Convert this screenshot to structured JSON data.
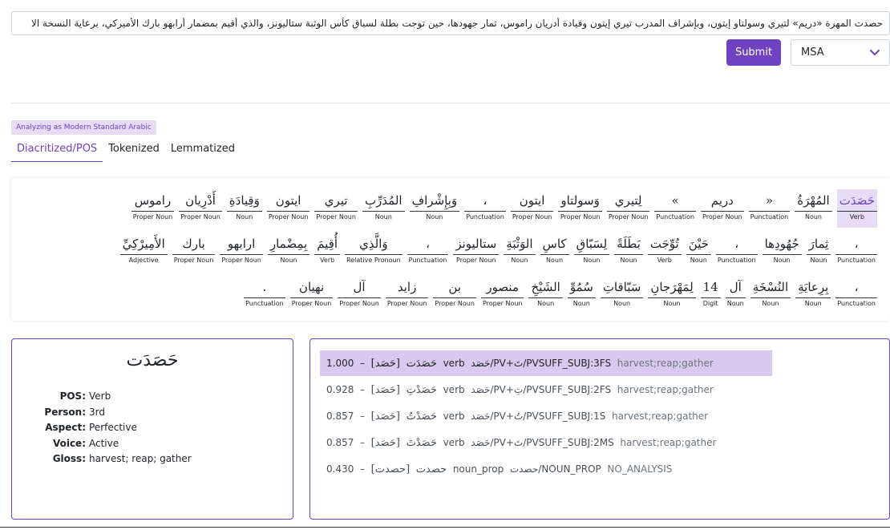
{
  "input": {
    "value": "حصدت المهرة «دريم» لتيري وسولتاو إيتون، وبإشراف المدرب تيري إيتون وقيادة أدريان راموس، ثمار جهودها، حين توجت بطلة لسباق كأس الوثبة ستاليونز، والذي أقيم بمضمار أرابهو بارك الأميركي، برعاية النسخة الا"
  },
  "toolbar": {
    "submit_label": "Submit",
    "dialect": "MSA"
  },
  "mode_badge": "Analyzing as Modern Standard Arabic",
  "tabs": [
    {
      "label": "Diacritized/POS",
      "active": true
    },
    {
      "label": "Tokenized",
      "active": false
    },
    {
      "label": "Lemmatized",
      "active": false
    }
  ],
  "pos_lines": [
    [
      {
        "w": "حَصَدَت",
        "p": "Verb",
        "sel": true
      },
      {
        "w": "المُهْرَةُ",
        "p": "Noun"
      },
      {
        "w": "«",
        "p": "Punctuation"
      },
      {
        "w": "دريم",
        "p": "Proper Noun"
      },
      {
        "w": "»",
        "p": "Punctuation"
      },
      {
        "w": "لِتيري",
        "p": "Proper Noun"
      },
      {
        "w": "وَسولتاو",
        "p": "Proper Noun"
      },
      {
        "w": "ايتون",
        "p": "Proper Noun"
      },
      {
        "w": "،",
        "p": "Punctuation"
      },
      {
        "w": "وَبِإِشْرافِ",
        "p": "Noun"
      },
      {
        "w": "المُدَرِّبِ",
        "p": "Noun"
      },
      {
        "w": "تيري",
        "p": "Proper Noun"
      },
      {
        "w": "ايتون",
        "p": "Proper Noun"
      },
      {
        "w": "وَقِيادَةِ",
        "p": "Noun"
      },
      {
        "w": "أَدْرِيان",
        "p": "Proper Noun"
      },
      {
        "w": "راموس",
        "p": "Proper Noun"
      }
    ],
    [
      {
        "w": "،",
        "p": "Punctuation"
      },
      {
        "w": "ثِمارَ",
        "p": "Noun"
      },
      {
        "w": "جُهُودِها",
        "p": "Noun"
      },
      {
        "w": "،",
        "p": "Punctuation"
      },
      {
        "w": "حَيْنَ",
        "p": "Noun"
      },
      {
        "w": "تُوِّجَت",
        "p": "Verb"
      },
      {
        "w": "بَطَلَةً",
        "p": "Noun"
      },
      {
        "w": "لِسَبّاقِ",
        "p": "Noun"
      },
      {
        "w": "كاسِ",
        "p": "Noun"
      },
      {
        "w": "الوَثْبَةِ",
        "p": "Noun"
      },
      {
        "w": "ستاليونز",
        "p": "Proper Noun"
      },
      {
        "w": "،",
        "p": "Punctuation"
      },
      {
        "w": "وَالَّذِي",
        "p": "Relative Pronoun"
      },
      {
        "w": "أُقِيمَ",
        "p": "Verb"
      },
      {
        "w": "بِمِضْمارِ",
        "p": "Noun"
      },
      {
        "w": "ارابهو",
        "p": "Proper Noun"
      },
      {
        "w": "بارك",
        "p": "Proper Noun"
      },
      {
        "w": "الأَمِيرْكِيِّ",
        "p": "Adjective"
      }
    ],
    [
      {
        "w": "،",
        "p": "Punctuation"
      },
      {
        "w": "بِرِعايَةِ",
        "p": "Noun"
      },
      {
        "w": "النُسْخَةِ",
        "p": "Noun"
      },
      {
        "w": "آل",
        "p": "Noun"
      },
      {
        "w": "14",
        "p": "Digit"
      },
      {
        "w": "لِمَهْرَجانِ",
        "p": "Noun"
      },
      {
        "w": "سَبّاقاتِ",
        "p": "Noun"
      },
      {
        "w": "سُمُوِّ",
        "p": "Noun"
      },
      {
        "w": "الشَيْخِ",
        "p": "Noun"
      },
      {
        "w": "منصور",
        "p": "Proper Noun"
      },
      {
        "w": "بن",
        "p": "Proper Noun"
      },
      {
        "w": "زايد",
        "p": "Proper Noun"
      },
      {
        "w": "آل",
        "p": "Proper Noun"
      },
      {
        "w": "نهيان",
        "p": "Proper Noun"
      },
      {
        "w": ".",
        "p": "Punctuation"
      }
    ]
  ],
  "detail": {
    "word": "حَصَدَت",
    "props": [
      {
        "k": "POS:",
        "v": "Verb"
      },
      {
        "k": "Person:",
        "v": "3rd"
      },
      {
        "k": "Aspect:",
        "v": "Perfective"
      },
      {
        "k": "Voice:",
        "v": "Active"
      },
      {
        "k": "Gloss:",
        "v": "harvest; reap; gather"
      }
    ]
  },
  "analyses": [
    {
      "score": "1.000",
      "dash": "–",
      "diac": "حَصَدَت",
      "lemma": "[حَصَد]",
      "pos": "verb",
      "bw": "حَصَد/PV+تَ/PVSUFF_SUBJ:3FS",
      "gloss": "harvest;reap;gather",
      "sel": true
    },
    {
      "score": "0.928",
      "dash": "–",
      "diac": "حَصَدْتِ",
      "lemma": "[حَصَد]",
      "pos": "verb",
      "bw": "حَصَد/PV+تِ/PVSUFF_SUBJ:2FS",
      "gloss": "harvest;reap;gather"
    },
    {
      "score": "0.857",
      "dash": "–",
      "diac": "حَصَدْتُ",
      "lemma": "[حَصَد]",
      "pos": "verb",
      "bw": "حَصَد/PV+تُ/PVSUFF_SUBJ:1S",
      "gloss": "harvest;reap;gather"
    },
    {
      "score": "0.857",
      "dash": "–",
      "diac": "حَصَدْتَ",
      "lemma": "[حَصَد]",
      "pos": "verb",
      "bw": "حَصَد/PV+تَ/PVSUFF_SUBJ:2MS",
      "gloss": "harvest;reap;gather"
    },
    {
      "score": "0.430",
      "dash": "–",
      "diac": "حصدت",
      "lemma": "[حصدت]",
      "pos": "noun_prop",
      "bw": "حصدت/NOUN_PROP",
      "gloss": "NO_ANALYSIS"
    }
  ]
}
